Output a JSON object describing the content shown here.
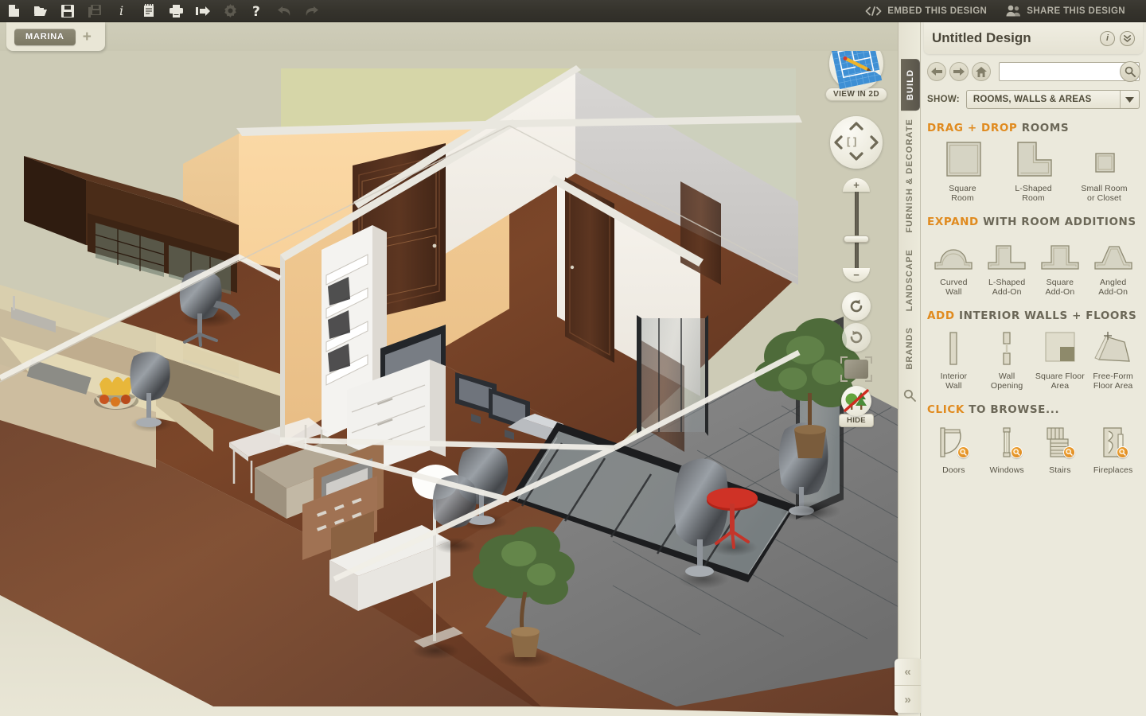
{
  "toolbar": {
    "icons": [
      {
        "name": "new-document-icon",
        "label": "New",
        "disabled": false
      },
      {
        "name": "open-folder-icon",
        "label": "Open",
        "disabled": false
      },
      {
        "name": "save-icon",
        "label": "Save",
        "disabled": false
      },
      {
        "name": "save-as-icon",
        "label": "Save As",
        "disabled": true
      },
      {
        "name": "info-icon",
        "label": "Info",
        "disabled": false
      },
      {
        "name": "notes-icon",
        "label": "Notes",
        "disabled": false
      },
      {
        "name": "print-icon",
        "label": "Print",
        "disabled": false
      },
      {
        "name": "export-icon",
        "label": "Export",
        "disabled": false
      },
      {
        "name": "settings-gear-icon",
        "label": "Settings",
        "disabled": true
      },
      {
        "name": "help-icon",
        "label": "Help",
        "disabled": false
      },
      {
        "name": "undo-icon",
        "label": "Undo",
        "disabled": true
      },
      {
        "name": "redo-icon",
        "label": "Redo",
        "disabled": true
      }
    ],
    "embed_label": "EMBED THIS DESIGN",
    "share_label": "SHARE THIS DESIGN"
  },
  "tabs": {
    "project_name": "MARINA",
    "add_label": "+"
  },
  "viewer": {
    "view_2d_label": "VIEW IN 2D",
    "hide_label": "HIDE",
    "pan_center": "[ ]",
    "zoom_in": "+",
    "zoom_out": "−"
  },
  "vertical_tabs": [
    {
      "label": "BUILD",
      "active": true,
      "name": "vtab-build"
    },
    {
      "label": "FURNISH & DECORATE",
      "active": false,
      "name": "vtab-furnish-decorate"
    },
    {
      "label": "LANDSCAPE",
      "active": false,
      "name": "vtab-landscape"
    },
    {
      "label": "BRANDS",
      "active": false,
      "name": "vtab-brands"
    }
  ],
  "panel": {
    "title": "Untitled Design",
    "info_button": "i",
    "collapse_button": "»",
    "search_value": "",
    "search_placeholder": "",
    "show_label": "SHOW:",
    "show_value": "ROOMS, WALLS & AREAS",
    "sections": [
      {
        "name": "drag-drop-rooms",
        "head_accent": "DRAG + DROP",
        "head_rest": " ROOMS",
        "items": [
          {
            "label": "Square\nRoom",
            "icon": "square-room-icon"
          },
          {
            "label": "L-Shaped\nRoom",
            "icon": "l-shaped-room-icon"
          },
          {
            "label": "Small Room\nor Closet",
            "icon": "small-room-icon"
          }
        ]
      },
      {
        "name": "room-additions",
        "head_accent": "EXPAND",
        "head_rest": " WITH ROOM ADDITIONS",
        "items": [
          {
            "label": "Curved\nWall",
            "icon": "curved-wall-icon"
          },
          {
            "label": "L-Shaped\nAdd-On",
            "icon": "l-shaped-addon-icon"
          },
          {
            "label": "Square\nAdd-On",
            "icon": "square-addon-icon"
          },
          {
            "label": "Angled\nAdd-On",
            "icon": "angled-addon-icon"
          }
        ]
      },
      {
        "name": "interior-walls-floors",
        "head_accent": "ADD",
        "head_rest": " INTERIOR WALLS + FLOORS",
        "items": [
          {
            "label": "Interior\nWall",
            "icon": "interior-wall-icon"
          },
          {
            "label": "Wall\nOpening",
            "icon": "wall-opening-icon"
          },
          {
            "label": "Square Floor\nArea",
            "icon": "square-floor-area-icon"
          },
          {
            "label": "Free-Form\nFloor Area",
            "icon": "free-form-floor-area-icon"
          }
        ]
      },
      {
        "name": "click-to-browse",
        "head_accent": "CLICK",
        "head_rest": " TO BROWSE...",
        "items": [
          {
            "label": "Doors",
            "icon": "door-icon",
            "badge": true
          },
          {
            "label": "Windows",
            "icon": "window-icon",
            "badge": true
          },
          {
            "label": "Stairs",
            "icon": "stairs-icon",
            "badge": true
          },
          {
            "label": "Fireplaces",
            "icon": "fireplace-icon",
            "badge": true
          }
        ]
      }
    ]
  },
  "collapse": {
    "prev_label": "«",
    "next_label": "»"
  },
  "colors": {
    "toolbar_bg": "#35332c",
    "canvas_bg": "#cdcbb6",
    "panel_bg": "#ebe9dc",
    "accent_orange": "#e08a1e",
    "tab_active": "#5f5b4e",
    "text_dark": "#4a4639"
  }
}
